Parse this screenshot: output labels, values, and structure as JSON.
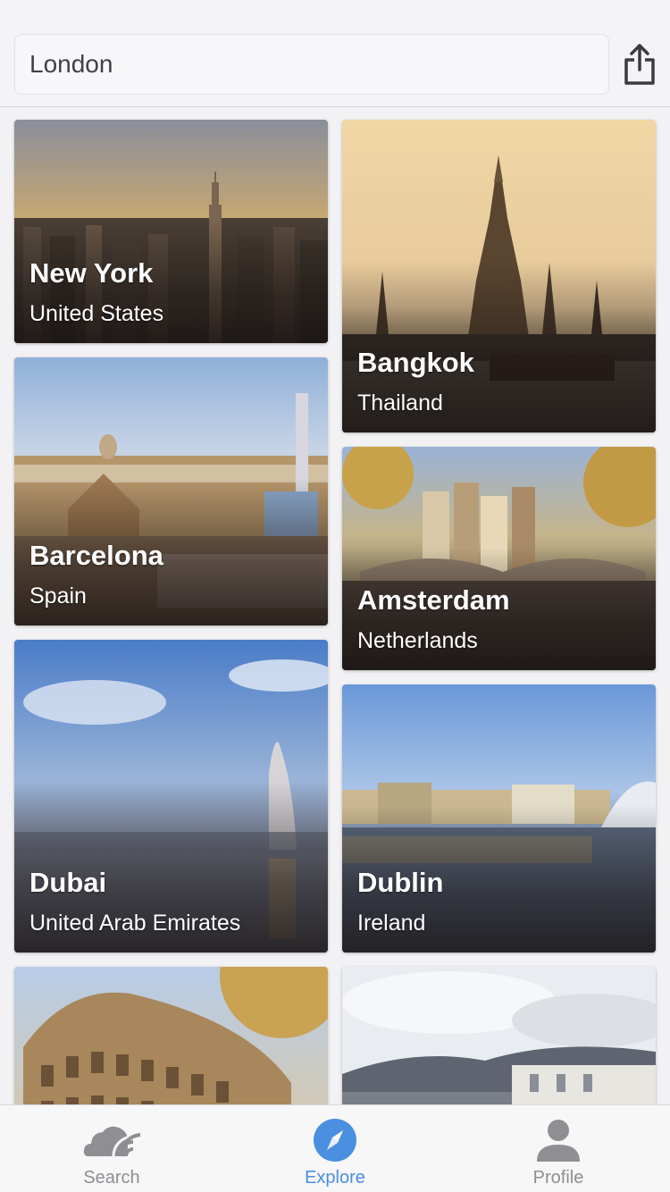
{
  "search": {
    "value": "London"
  },
  "share_icon": "share-icon",
  "destinations": [
    {
      "city": "New York",
      "country": "United States"
    },
    {
      "city": "Bangkok",
      "country": "Thailand"
    },
    {
      "city": "Barcelona",
      "country": "Spain"
    },
    {
      "city": "Amsterdam",
      "country": "Netherlands"
    },
    {
      "city": "Dubai",
      "country": "United Arab Emirates"
    },
    {
      "city": "Dublin",
      "country": "Ireland"
    },
    {
      "city": "",
      "country": ""
    },
    {
      "city": "",
      "country": ""
    }
  ],
  "tabs": [
    {
      "label": "Search",
      "icon": "search-cloud-icon",
      "active": false
    },
    {
      "label": "Explore",
      "icon": "compass-icon",
      "active": true
    },
    {
      "label": "Profile",
      "icon": "person-icon",
      "active": false
    }
  ],
  "colors": {
    "accent": "#4a8fe0",
    "inactive": "#8e8e93"
  }
}
